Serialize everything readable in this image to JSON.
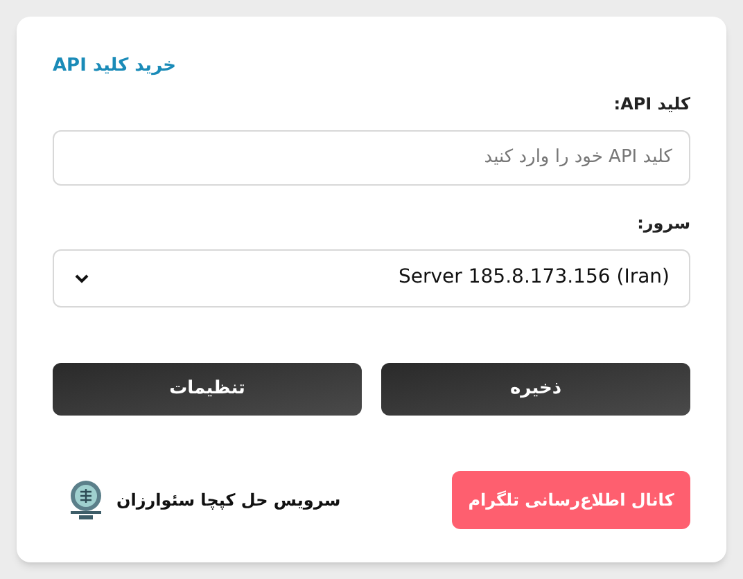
{
  "buy_link": "خرید کلید API",
  "api_key": {
    "label": "کلید API:",
    "placeholder": "کلید API خود را وارد کنید"
  },
  "server": {
    "label": "سرور:",
    "value": "Server 185.8.173.156 (Iran)"
  },
  "buttons": [
    {
      "label": "ذخیره"
    },
    {
      "label": "تنظیمات"
    }
  ],
  "telegram_button": "کانال اطلاع‌رسانی تلگرام",
  "service_name": "سرویس حل کپچا سئوارزان"
}
